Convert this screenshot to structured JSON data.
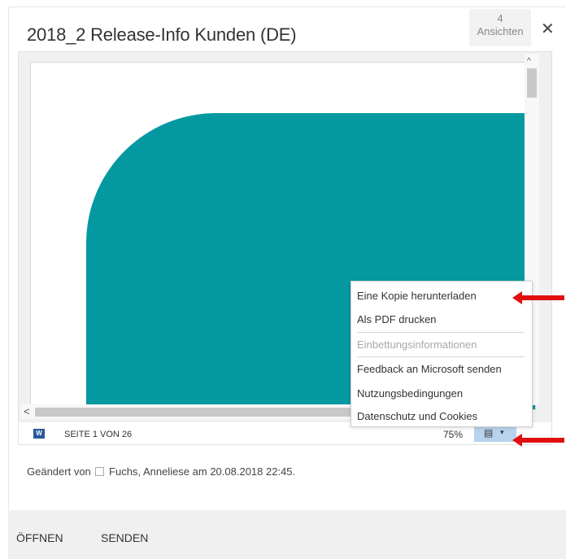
{
  "dialog": {
    "title": "2018_2 Release-Info Kunden (DE)",
    "views_count": "4",
    "views_label": "Ansichten",
    "close_glyph": "✕"
  },
  "viewer": {
    "page_info": "SEITE 1 VON 26",
    "zoom": "75%",
    "word_icon_letter": "W",
    "menu_glyph": "▤",
    "caret_glyph": "▾",
    "scroll_up_glyph": "^",
    "scroll_left_glyph": "<",
    "page_shape_color": "#0499a1",
    "menu": {
      "items": [
        "Eine Kopie herunterladen",
        "Als PDF drucken",
        "Einbettungsinformationen",
        "Feedback an Microsoft senden",
        "Nutzungsbedingungen",
        "Datenschutz und Cookies"
      ]
    }
  },
  "modified": {
    "prefix": "Geändert von",
    "text": "Fuchs, Anneliese am 20.08.2018 22:45."
  },
  "footer": {
    "open_label": "ÖFFNEN",
    "send_label": "SENDEN"
  },
  "annotations": {
    "arrow_color": "#e01010"
  }
}
